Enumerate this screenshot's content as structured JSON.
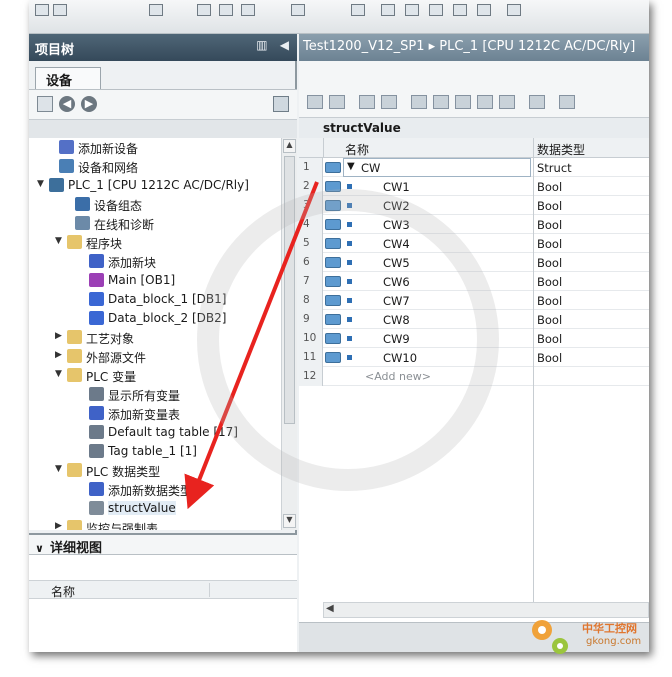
{
  "left_panel": {
    "title": "项目树",
    "tab": "设备",
    "tree": [
      {
        "label": "添加新设备",
        "icon": "add-device-icon"
      },
      {
        "label": "设备和网络",
        "icon": "network-icon"
      },
      {
        "label": "PLC_1 [CPU 1212C AC/DC/Rly]",
        "icon": "plc-icon",
        "expanded": true
      },
      {
        "label": "设备组态",
        "icon": "device-config-icon"
      },
      {
        "label": "在线和诊断",
        "icon": "online-diagnostics-icon"
      },
      {
        "label": "程序块",
        "icon": "folder-icon",
        "expanded": true
      },
      {
        "label": "添加新块",
        "icon": "add-block-icon"
      },
      {
        "label": "Main [OB1]",
        "icon": "ob-icon"
      },
      {
        "label": "Data_block_1 [DB1]",
        "icon": "db-icon"
      },
      {
        "label": "Data_block_2 [DB2]",
        "icon": "db-icon"
      },
      {
        "label": "工艺对象",
        "icon": "folder-icon",
        "expanded": false
      },
      {
        "label": "外部源文件",
        "icon": "folder-icon",
        "expanded": false
      },
      {
        "label": "PLC 变量",
        "icon": "folder-icon",
        "expanded": true
      },
      {
        "label": "显示所有变量",
        "icon": "show-tags-icon"
      },
      {
        "label": "添加新变量表",
        "icon": "add-tag-table-icon"
      },
      {
        "label": "Default tag table [17]",
        "icon": "tag-table-icon"
      },
      {
        "label": "Tag table_1 [1]",
        "icon": "tag-table-icon"
      },
      {
        "label": "PLC 数据类型",
        "icon": "folder-icon",
        "expanded": true
      },
      {
        "label": "添加新数据类型",
        "icon": "add-datatype-icon"
      },
      {
        "label": "structValue",
        "icon": "datatype-icon",
        "selected": true
      },
      {
        "label": "监控与强制表",
        "icon": "folder-icon",
        "expanded": false
      }
    ],
    "detail_title": "详细视图",
    "detail_column": "名称"
  },
  "editor": {
    "title": "Test1200_V12_SP1 ▸ PLC_1 [CPU 1212C AC/DC/Rly]",
    "type_name": "structValue",
    "col_name": "名称",
    "col_type": "数据类型",
    "rows": [
      {
        "num": "1",
        "name": "CW",
        "type": "Struct"
      },
      {
        "num": "2",
        "name": "CW1",
        "type": "Bool"
      },
      {
        "num": "3",
        "name": "CW2",
        "type": "Bool"
      },
      {
        "num": "4",
        "name": "CW3",
        "type": "Bool"
      },
      {
        "num": "5",
        "name": "CW4",
        "type": "Bool"
      },
      {
        "num": "6",
        "name": "CW5",
        "type": "Bool"
      },
      {
        "num": "7",
        "name": "CW6",
        "type": "Bool"
      },
      {
        "num": "8",
        "name": "CW7",
        "type": "Bool"
      },
      {
        "num": "9",
        "name": "CW8",
        "type": "Bool"
      },
      {
        "num": "10",
        "name": "CW9",
        "type": "Bool"
      },
      {
        "num": "11",
        "name": "CW10",
        "type": "Bool"
      }
    ],
    "add_row_num": "12",
    "add_new": "<Add new>"
  },
  "watermark": {
    "line1": "中华工控网",
    "line2": "gkong.com"
  },
  "annotation_arrow_color": "#e8231f"
}
